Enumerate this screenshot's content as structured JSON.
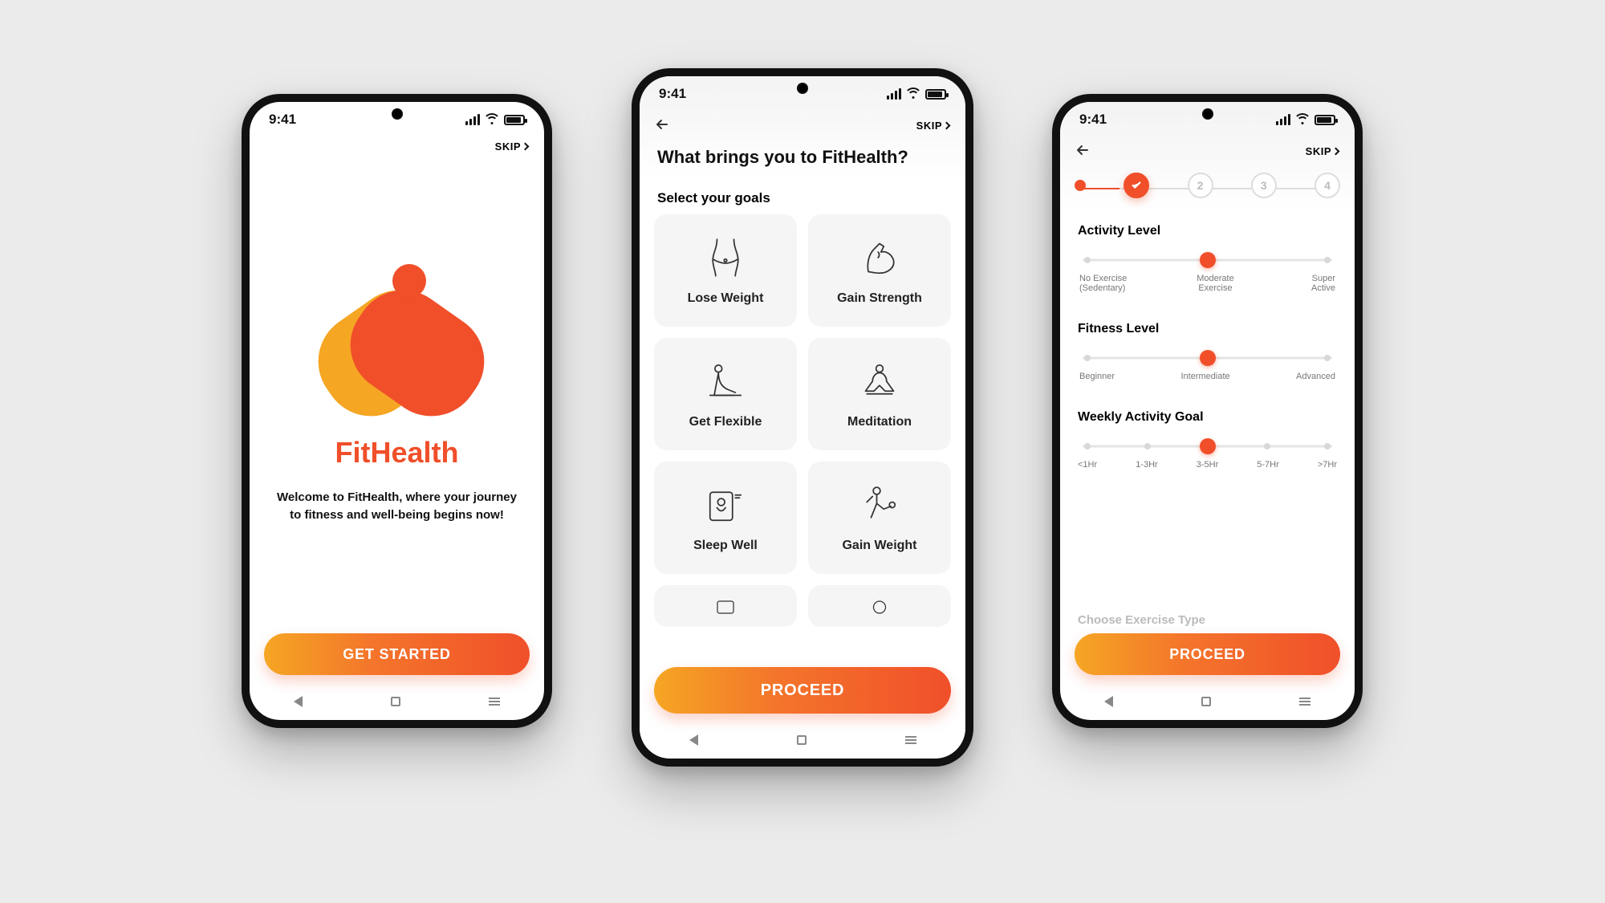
{
  "colors": {
    "accent": "#f04f2a",
    "accentGradientStart": "#f5a623",
    "accentGradientEnd": "#f04f2a"
  },
  "status": {
    "time": "9:41"
  },
  "skip": {
    "label": "SKIP"
  },
  "screen1": {
    "brand": "FitHealth",
    "welcome": "Welcome to FitHealth, where your journey to fitness and well-being begins now!",
    "cta": "GET STARTED"
  },
  "screen2": {
    "title": "What brings you to FitHealth?",
    "subhead": "Select your goals",
    "goals": [
      {
        "id": "lose-weight",
        "label": "Lose Weight",
        "icon": "waist-icon"
      },
      {
        "id": "gain-strength",
        "label": "Gain Strength",
        "icon": "bicep-icon"
      },
      {
        "id": "get-flexible",
        "label": "Get Flexible",
        "icon": "stretch-icon"
      },
      {
        "id": "meditation",
        "label": "Meditation",
        "icon": "meditation-icon"
      },
      {
        "id": "sleep-well",
        "label": "Sleep Well",
        "icon": "sleep-icon"
      },
      {
        "id": "gain-weight",
        "label": "Gain Weight",
        "icon": "dumbbell-person-icon"
      }
    ],
    "cta": "PROCEED"
  },
  "screen3": {
    "steps": {
      "total": 4,
      "current": 1,
      "labels": [
        "",
        "",
        "2",
        "3",
        "4"
      ]
    },
    "sections": {
      "activity": {
        "title": "Activity Level",
        "ticks": 3,
        "value": 1,
        "labels": [
          "No Exercise (Sedentary)",
          "Moderate Exercise",
          "Super Active"
        ]
      },
      "fitness": {
        "title": "Fitness Level",
        "ticks": 3,
        "value": 1,
        "labels": [
          "Beginner",
          "Intermediate",
          "Advanced"
        ]
      },
      "weekly": {
        "title": "Weekly Activity Goal",
        "ticks": 5,
        "value": 2,
        "labels": [
          "<1Hr",
          "1-3Hr",
          "3-5Hr",
          "5-7Hr",
          ">7Hr"
        ]
      }
    },
    "nextFaded": "Choose Exercise Type",
    "cta": "PROCEED"
  }
}
